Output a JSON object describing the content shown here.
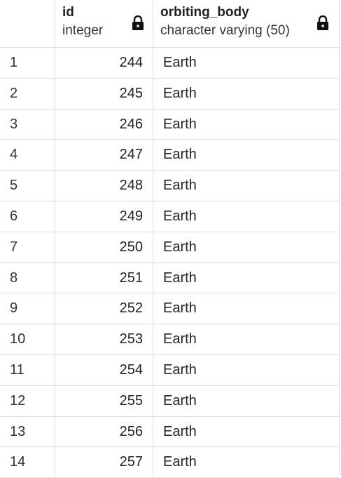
{
  "columns": [
    {
      "name": "id",
      "type": "integer",
      "locked": true
    },
    {
      "name": "orbiting_body",
      "type": "character varying (50)",
      "locked": true
    }
  ],
  "rows": [
    {
      "num": "1",
      "id": "244",
      "orbiting_body": "Earth"
    },
    {
      "num": "2",
      "id": "245",
      "orbiting_body": "Earth"
    },
    {
      "num": "3",
      "id": "246",
      "orbiting_body": "Earth"
    },
    {
      "num": "4",
      "id": "247",
      "orbiting_body": "Earth"
    },
    {
      "num": "5",
      "id": "248",
      "orbiting_body": "Earth"
    },
    {
      "num": "6",
      "id": "249",
      "orbiting_body": "Earth"
    },
    {
      "num": "7",
      "id": "250",
      "orbiting_body": "Earth"
    },
    {
      "num": "8",
      "id": "251",
      "orbiting_body": "Earth"
    },
    {
      "num": "9",
      "id": "252",
      "orbiting_body": "Earth"
    },
    {
      "num": "10",
      "id": "253",
      "orbiting_body": "Earth"
    },
    {
      "num": "11",
      "id": "254",
      "orbiting_body": "Earth"
    },
    {
      "num": "12",
      "id": "255",
      "orbiting_body": "Earth"
    },
    {
      "num": "13",
      "id": "256",
      "orbiting_body": "Earth"
    },
    {
      "num": "14",
      "id": "257",
      "orbiting_body": "Earth"
    }
  ],
  "icons": {
    "lock": "lock-icon"
  },
  "colors": {
    "grid_line": "#dcdcdc",
    "text": "#222222"
  }
}
